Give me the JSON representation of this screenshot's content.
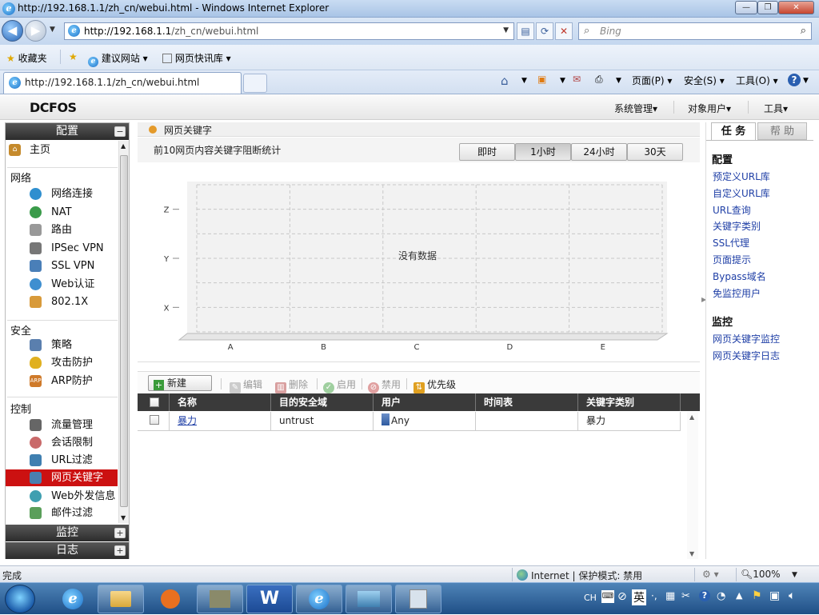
{
  "browser": {
    "title": "http://192.168.1.1/zh_cn/webui.html - Windows Internet Explorer",
    "url_host": "http://192.168.1.1",
    "url_path": "/zh_cn/webui.html",
    "search_placeholder": "Bing",
    "favorites_label": "收藏夹",
    "fav_items": [
      "建议网站",
      "网页快讯库"
    ],
    "tab_title": "http://192.168.1.1/zh_cn/webui.html",
    "cmd_page": "页面(P)",
    "cmd_safety": "安全(S)",
    "cmd_tools": "工具(O)"
  },
  "app": {
    "logo": "DCFOS",
    "menus": [
      "系统管理",
      "对象用户",
      "工具"
    ]
  },
  "sidebar": {
    "config_head": "配置",
    "home": "主页",
    "sections": {
      "network": "网络",
      "security": "安全",
      "control": "控制"
    },
    "network_items": [
      "网络连接",
      "NAT",
      "路由",
      "IPSec VPN",
      "SSL VPN",
      "Web认证",
      "802.1X"
    ],
    "security_items": [
      "策略",
      "攻击防护",
      "ARP防护"
    ],
    "control_items": [
      "流量管理",
      "会话限制",
      "URL过滤",
      "网页关键字",
      "Web外发信息",
      "邮件过滤"
    ],
    "monitor_head": "监控",
    "log_head": "日志"
  },
  "main": {
    "breadcrumb": "网页关键字",
    "stat_title": "前10网页内容关键字阻断统计",
    "range_buttons": [
      "即时",
      "1小时",
      "24小时",
      "30天"
    ],
    "range_selected": "1小时",
    "toolbar": {
      "new": "新建",
      "edit": "编辑",
      "delete": "删除",
      "enable": "启用",
      "disable": "禁用",
      "priority": "优先级"
    },
    "columns": [
      "名称",
      "目的安全域",
      "用户",
      "时间表",
      "关键字类别"
    ],
    "rows": [
      {
        "name": "暴力",
        "zone": "untrust",
        "user": "Any",
        "schedule": "",
        "category": "暴力"
      }
    ]
  },
  "chart_data": {
    "type": "bar",
    "categories": [
      "A",
      "B",
      "C",
      "D",
      "E"
    ],
    "y_categories": [
      "X",
      "Y",
      "Z"
    ],
    "values": [],
    "empty_message": "没有数据",
    "grid": true
  },
  "rpanel": {
    "tab_task": "任 务",
    "tab_help": "帮 助",
    "config_title": "配置",
    "config_links": [
      "预定义URL库",
      "自定义URL库",
      "URL查询",
      "关键字类别",
      "SSL代理",
      "页面提示",
      "Bypass域名",
      "免监控用户"
    ],
    "monitor_title": "监控",
    "monitor_links": [
      "网页关键字监控",
      "网页关键字日志"
    ]
  },
  "statusbar": {
    "done": "完成",
    "zone": "Internet | 保护模式: 禁用",
    "zoom": "100%"
  },
  "taskbar": {
    "tray_lang": "CH",
    "tray_ime": "英"
  },
  "colors": {
    "active_nav": "#cc1111",
    "link": "#1f3fa6",
    "header_dark": "#3a3a3a"
  }
}
